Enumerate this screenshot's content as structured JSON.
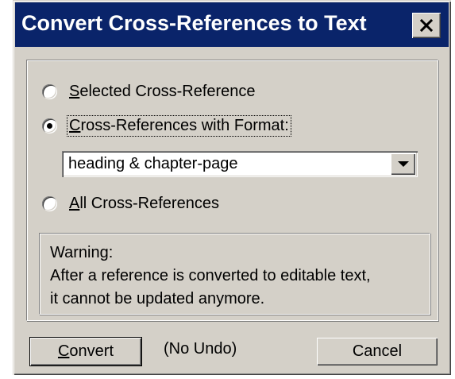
{
  "window": {
    "title": "Convert Cross-References to Text",
    "close_icon": "close-icon"
  },
  "options": [
    {
      "label_prefix": "",
      "mnemonic": "S",
      "label_rest": "elected Cross-Reference",
      "checked": false
    },
    {
      "label_prefix": "",
      "mnemonic": "C",
      "label_rest": "ross-References with Format:",
      "checked": true
    },
    {
      "label_prefix": "",
      "mnemonic": "A",
      "label_rest": "ll Cross-References",
      "checked": false
    }
  ],
  "format_select": {
    "value": "heading & chapter-page",
    "arrow_icon": "chevron-down-icon"
  },
  "warning": {
    "heading": "Warning:",
    "line1": "After a reference is converted to editable text,",
    "line2": "it cannot be updated anymore."
  },
  "buttons": {
    "convert_mnemonic": "C",
    "convert_rest": "onvert",
    "no_undo_note": "(No Undo)",
    "cancel": "Cancel"
  },
  "colors": {
    "titlebar": "#0a246a",
    "face": "#d4d0c8"
  }
}
